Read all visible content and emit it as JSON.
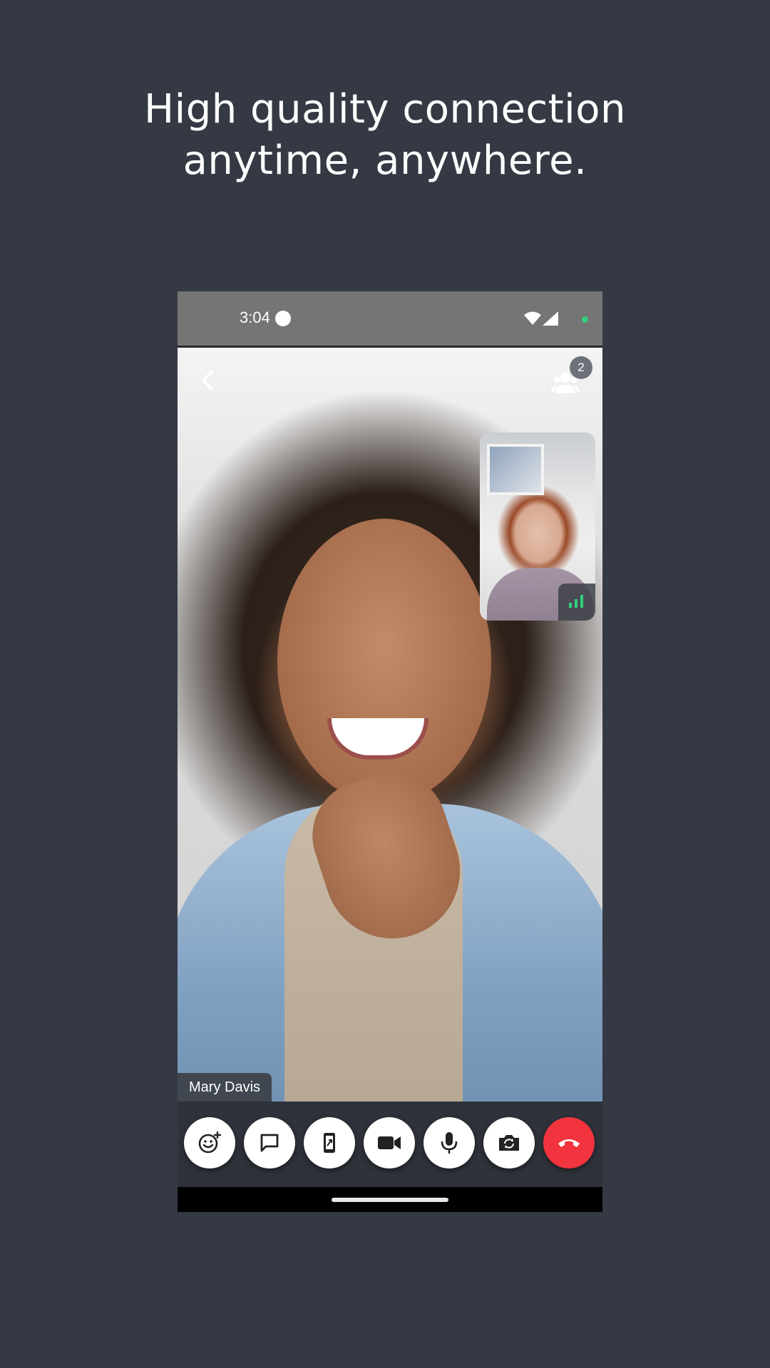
{
  "headline": {
    "line1": "High quality connection",
    "line2": "anytime, anywhere."
  },
  "status_bar": {
    "time": "3:04"
  },
  "call": {
    "participants_count": "2",
    "remote_name": "Mary Davis"
  },
  "controls": [
    {
      "name": "reactions",
      "icon": "emoji-add-icon"
    },
    {
      "name": "chat",
      "icon": "chat-bubble-icon"
    },
    {
      "name": "screen-share",
      "icon": "screen-share-icon"
    },
    {
      "name": "camera",
      "icon": "video-camera-icon"
    },
    {
      "name": "microphone",
      "icon": "microphone-icon"
    },
    {
      "name": "switch-camera",
      "icon": "switch-camera-icon"
    },
    {
      "name": "end-call",
      "icon": "hang-up-icon"
    }
  ],
  "colors": {
    "background": "#343944",
    "end_call": "#f2343f",
    "signal_good": "#2fd17c"
  }
}
